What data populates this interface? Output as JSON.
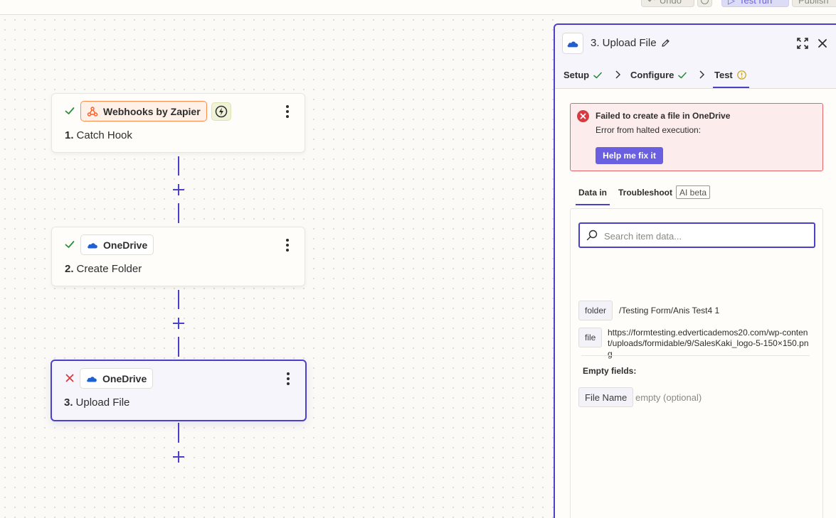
{
  "topbar": {
    "undo_label": "Undo",
    "test_run_label": "Test run",
    "publish_label": "Publish"
  },
  "canvas": {
    "steps": [
      {
        "number": "1.",
        "title": "Catch Hook",
        "app": "Webhooks by Zapier",
        "status": "success",
        "has_trigger_badge": true
      },
      {
        "number": "2.",
        "title": "Create Folder",
        "app": "OneDrive",
        "status": "success"
      },
      {
        "number": "3.",
        "title": "Upload File",
        "app": "OneDrive",
        "status": "error",
        "selected": true
      }
    ]
  },
  "panel": {
    "title": "3. Upload File",
    "tabs": [
      {
        "label": "Setup",
        "state": "complete"
      },
      {
        "label": "Configure",
        "state": "complete"
      },
      {
        "label": "Test",
        "state": "warning",
        "active": true
      }
    ],
    "error": {
      "title": "Failed to create a file in OneDrive",
      "message": "Error from halted execution:",
      "button_label": "Help me fix it"
    },
    "subtabs": {
      "data_in": "Data in",
      "troubleshoot": "Troubleshoot",
      "ai_badge": "AI beta"
    },
    "search": {
      "placeholder": "Search item data..."
    },
    "fields": [
      {
        "key": "folder",
        "value": "/Testing Form/Anis Test4 1"
      },
      {
        "key": "file",
        "value": "https://formtesting.edverticademos20.com/wp-content/uploads/formidable/9/SalesKaki_logo-5-150×150.png"
      }
    ],
    "empty_heading": "Empty fields:",
    "empty_fields": [
      {
        "key": "File Name",
        "value": "empty (optional)"
      }
    ]
  },
  "colors": {
    "accent": "#4a40c9",
    "success": "#2e8b3e",
    "error": "#d93a42",
    "warning": "#c9a21a",
    "webhooks_orange": "#ff5a1f",
    "onedrive_blue": "#1e5fd1"
  }
}
